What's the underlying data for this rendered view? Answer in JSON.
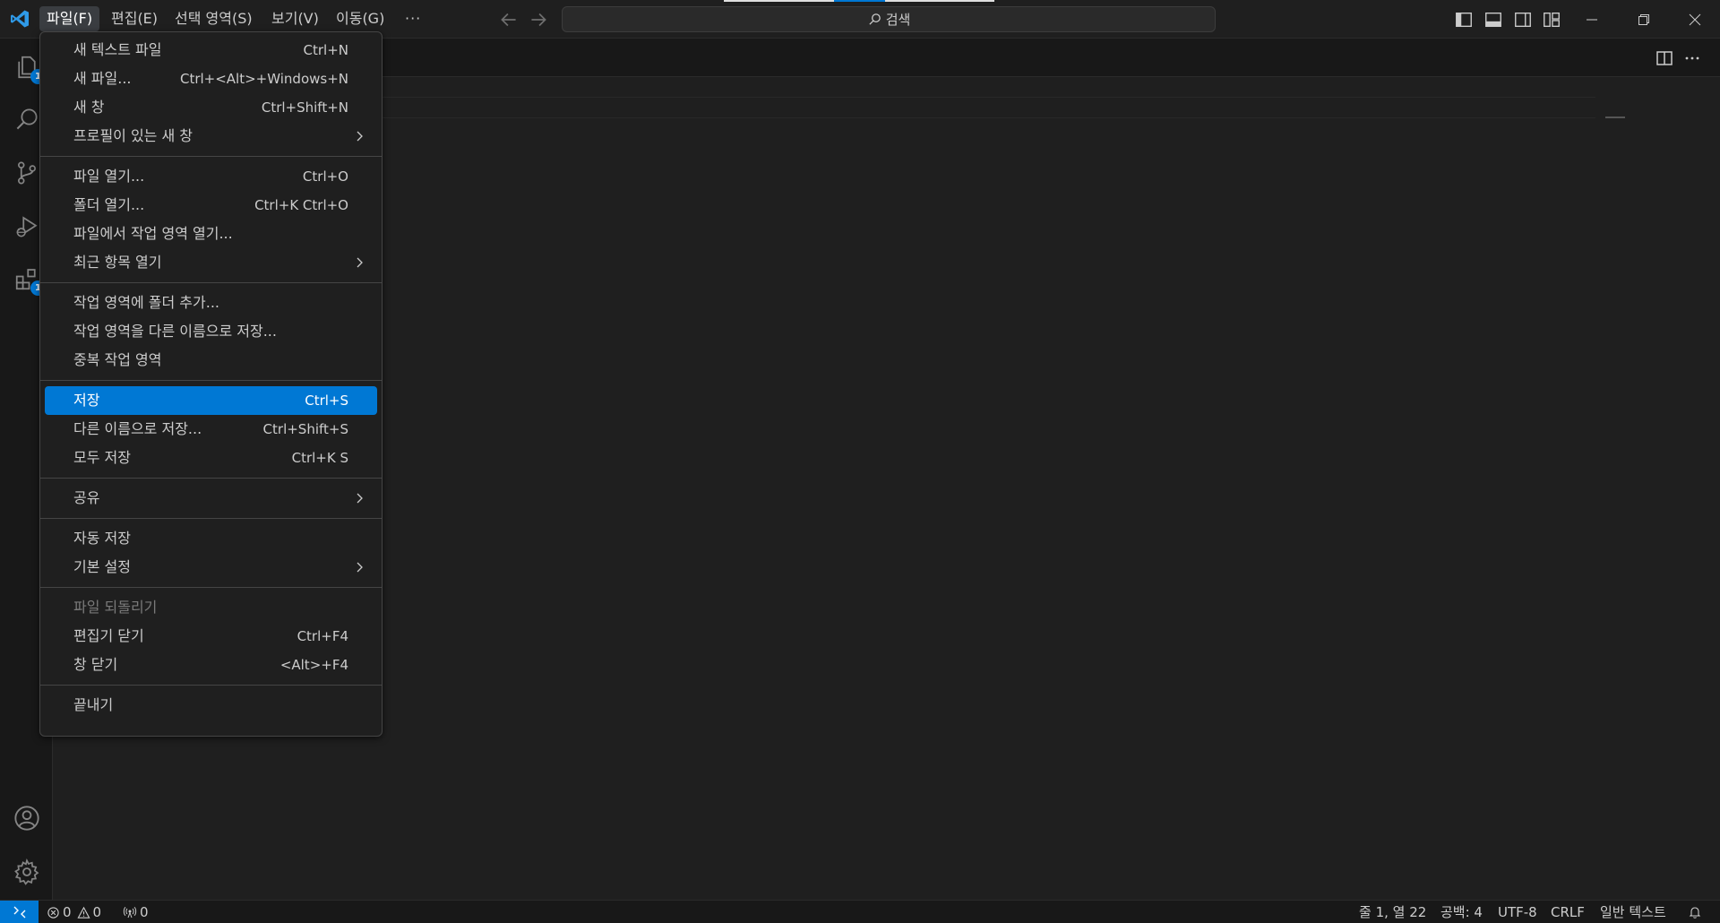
{
  "titlebar": {
    "menus": [
      {
        "label": "파일(F)"
      },
      {
        "label": "편집(E)"
      },
      {
        "label": "선택 영역(S)"
      },
      {
        "label": "보기(V)"
      },
      {
        "label": "이동(G)"
      }
    ],
    "more_label": "···",
    "search_label": "검색"
  },
  "file_menu": {
    "g1": [
      {
        "label": "새 텍스트 파일",
        "shortcut": "Ctrl+N"
      },
      {
        "label": "새 파일...",
        "shortcut": "Ctrl+<Alt>+Windows+N"
      },
      {
        "label": "새 창",
        "shortcut": "Ctrl+Shift+N"
      },
      {
        "label": "프로필이 있는 새 창",
        "shortcut": ""
      }
    ],
    "g2": [
      {
        "label": "파일 열기...",
        "shortcut": "Ctrl+O"
      },
      {
        "label": "폴더 열기...",
        "shortcut": "Ctrl+K Ctrl+O"
      },
      {
        "label": "파일에서 작업 영역 열기...",
        "shortcut": ""
      },
      {
        "label": "최근 항목 열기",
        "shortcut": ""
      }
    ],
    "g3": [
      {
        "label": "작업 영역에 폴더 추가..."
      },
      {
        "label": "작업 영역을 다른 이름으로 저장..."
      },
      {
        "label": "중복 작업 영역"
      }
    ],
    "g4": [
      {
        "label": "저장",
        "shortcut": "Ctrl+S"
      },
      {
        "label": "다른 이름으로 저장...",
        "shortcut": "Ctrl+Shift+S"
      },
      {
        "label": "모두 저장",
        "shortcut": "Ctrl+K S"
      }
    ],
    "g5": [
      {
        "label": "공유"
      }
    ],
    "g6": [
      {
        "label": "자동 저장"
      },
      {
        "label": "기본 설정"
      }
    ],
    "g7": [
      {
        "label": "파일 되돌리기",
        "shortcut": ""
      },
      {
        "label": "편집기 닫기",
        "shortcut": "Ctrl+F4"
      },
      {
        "label": "창 닫기",
        "shortcut": "<Alt>+F4"
      }
    ],
    "g8": [
      {
        "label": "끝내기"
      }
    ]
  },
  "activitybar": {
    "explorer_badge": "1",
    "extensions_badge": "1"
  },
  "statusbar": {
    "errors": "0",
    "warnings": "0",
    "ports": "0",
    "cursor": "줄 1, 열 22",
    "indent": "공백: 4",
    "encoding": "UTF-8",
    "eol": "CRLF",
    "language": "일반 텍스트"
  },
  "colors": {
    "accent": "#0078d4",
    "background": "#1f1f1f",
    "menu_border": "#454545"
  }
}
